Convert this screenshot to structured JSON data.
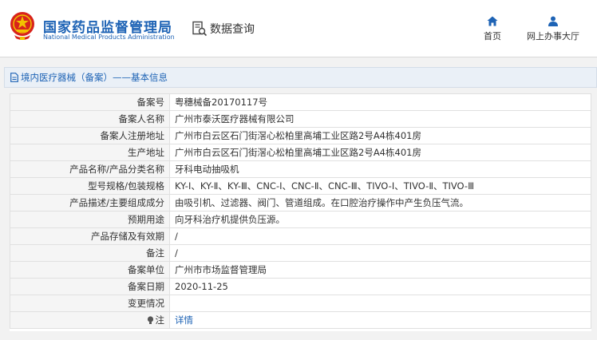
{
  "header": {
    "brand_cn": "国家药品监督管理局",
    "brand_en": "National Medical Products Administration",
    "search_label": "数据查询",
    "nav": {
      "home": "首页",
      "online_office": "网上办事大厅"
    }
  },
  "colors": {
    "brand_blue": "#1e63b5",
    "logo_red": "#d8241c",
    "logo_gold": "#f2c200"
  },
  "section": {
    "title": "境内医疗器械（备案）——基本信息"
  },
  "rows": [
    {
      "label": "备案号",
      "value": "粤穗械备20170117号"
    },
    {
      "label": "备案人名称",
      "value": "广州市泰沃医疗器械有限公司"
    },
    {
      "label": "备案人注册地址",
      "value": "广州市白云区石门街滘心松柏里高埔工业区路2号A4栋401房"
    },
    {
      "label": "生产地址",
      "value": "广州市白云区石门街滘心松柏里高埔工业区路2号A4栋401房"
    },
    {
      "label": "产品名称/产品分类名称",
      "value": "牙科电动抽吸机"
    },
    {
      "label": "型号规格/包装规格",
      "value": "KY-Ⅰ、KY-Ⅱ、KY-Ⅲ、CNC-Ⅰ、CNC-Ⅱ、CNC-Ⅲ、TIVO-Ⅰ、TIVO-Ⅱ、TIVO-Ⅲ"
    },
    {
      "label": "产品描述/主要组成成分",
      "value": "由吸引机、过滤器、阀门、管道组成。在口腔治疗操作中产生负压气流。"
    },
    {
      "label": "预期用途",
      "value": "向牙科治疗机提供负压源。"
    },
    {
      "label": "产品存储及有效期",
      "value": "/"
    },
    {
      "label": "备注",
      "value": "/"
    },
    {
      "label": "备案单位",
      "value": "广州市市场监督管理局"
    },
    {
      "label": "备案日期",
      "value": "2020-11-25"
    },
    {
      "label": "变更情况",
      "value": ""
    },
    {
      "label": "注",
      "value": "详情"
    }
  ]
}
